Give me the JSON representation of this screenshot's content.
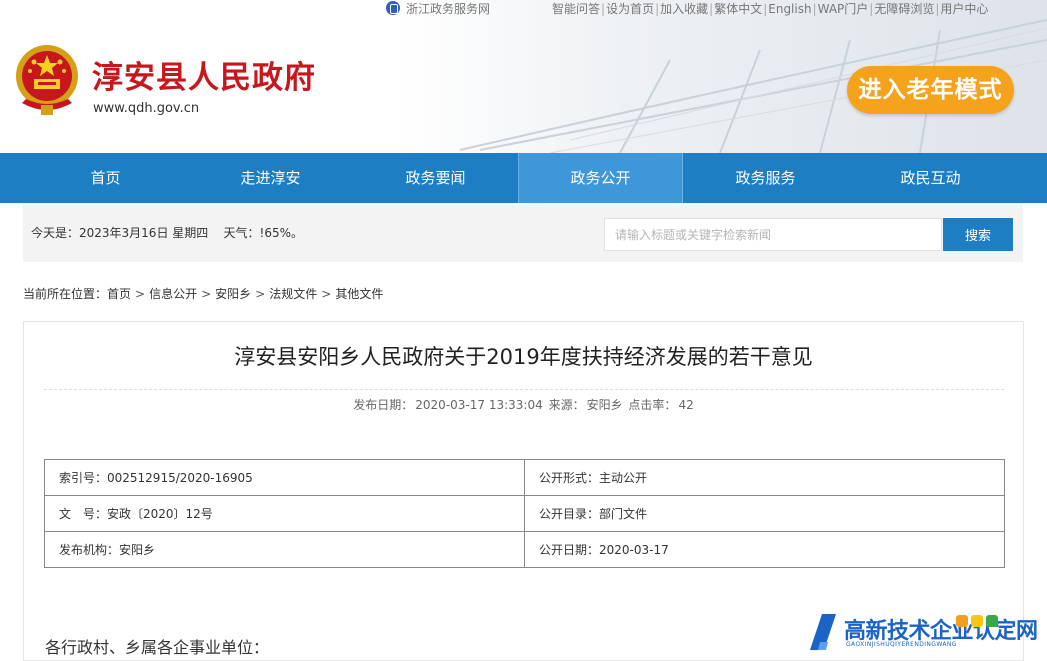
{
  "header": {
    "portal_link": "浙江政务服务网",
    "top_links": [
      "智能问答",
      "设为首页",
      "加入收藏",
      "繁体中文",
      "English",
      "WAP门户",
      "无障碍浏览",
      "用户中心"
    ],
    "site_title": "淳安县人民政府",
    "site_url": "www.qdh.gov.cn",
    "elder_mode_label": "进入老年模式",
    "elder_mode_color": "#f5a21d"
  },
  "nav": {
    "items": [
      "首页",
      "走进淳安",
      "政务要闻",
      "政务公开",
      "政务服务",
      "政民互动"
    ],
    "active": "政务公开",
    "color": "#1d7ec4"
  },
  "infobar": {
    "today_text": "今天是：2023年3月16日 星期四",
    "weather_label": "天气：",
    "weather_value": "!65%。",
    "search_placeholder": "请输入标题或关键字检索新闻",
    "search_button": "搜索"
  },
  "breadcrumb": {
    "prefix": "当前所在位置：",
    "items": [
      "首页",
      "信息公开",
      "安阳乡",
      "法规文件",
      "其他文件"
    ]
  },
  "article": {
    "title": "淳安县安阳乡人民政府关于2019年度扶持经济发展的若干意见",
    "publish_label": "发布日期：",
    "publish_date": "2020-03-17 13:33:04",
    "source_label": "来源：",
    "source": "安阳乡",
    "clicks_label": "点击率：",
    "clicks": "42",
    "info_table": [
      [
        "索引号：002512915/2020-16905",
        "公开形式：主动公开"
      ],
      [
        "文　号：安政〔2020〕12号",
        "公开目录：部门文件"
      ],
      [
        "发布机构：安阳乡",
        "公开日期：2020-03-17"
      ]
    ],
    "body_start": "各行政村、乡属各企事业单位："
  },
  "watermark": {
    "text": "高新技术企业认定网",
    "sub": "GAOXINJISHUQIYERENDINGWANG"
  }
}
